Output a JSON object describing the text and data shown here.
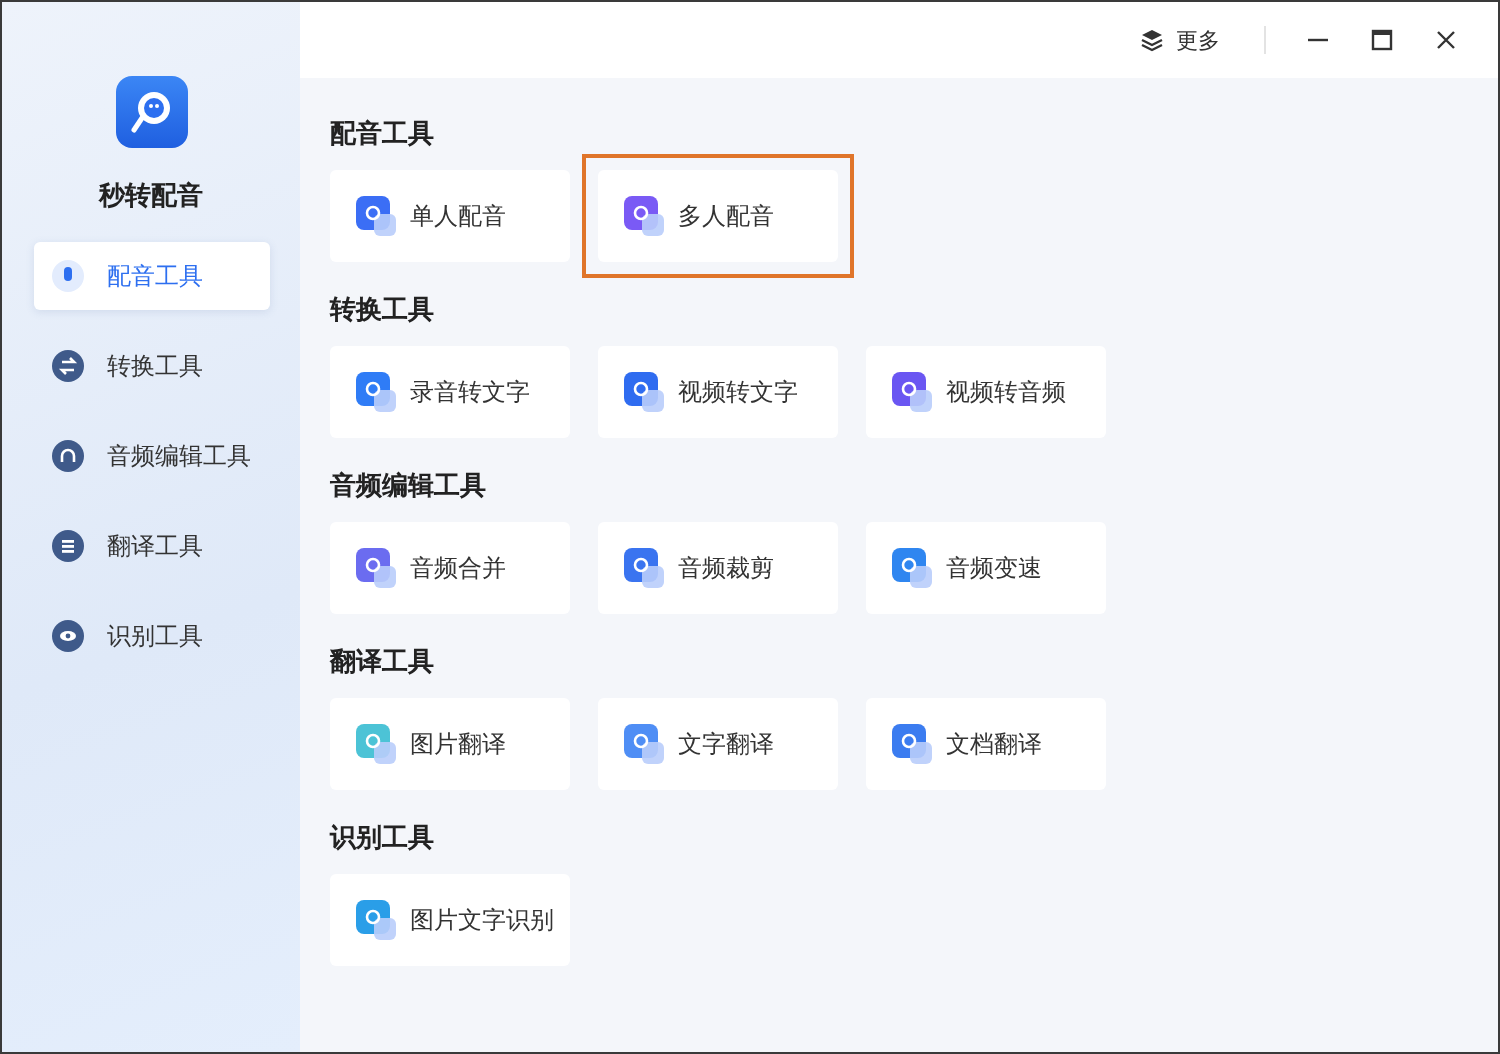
{
  "app": {
    "name": "秒转配音"
  },
  "sidebar": {
    "items": [
      {
        "label": "配音工具",
        "selected": true
      },
      {
        "label": "转换工具",
        "selected": false
      },
      {
        "label": "音频编辑工具",
        "selected": false
      },
      {
        "label": "翻译工具",
        "selected": false
      },
      {
        "label": "识别工具",
        "selected": false
      }
    ]
  },
  "titlebar": {
    "more": "更多"
  },
  "sections": [
    {
      "title": "配音工具",
      "tools": [
        {
          "label": "单人配音",
          "highlighted": false
        },
        {
          "label": "多人配音",
          "highlighted": true
        }
      ]
    },
    {
      "title": "转换工具",
      "tools": [
        {
          "label": "录音转文字",
          "highlighted": false
        },
        {
          "label": "视频转文字",
          "highlighted": false
        },
        {
          "label": "视频转音频",
          "highlighted": false
        }
      ]
    },
    {
      "title": "音频编辑工具",
      "tools": [
        {
          "label": "音频合并",
          "highlighted": false
        },
        {
          "label": "音频裁剪",
          "highlighted": false
        },
        {
          "label": "音频变速",
          "highlighted": false
        }
      ]
    },
    {
      "title": "翻译工具",
      "tools": [
        {
          "label": "图片翻译",
          "highlighted": false
        },
        {
          "label": "文字翻译",
          "highlighted": false
        },
        {
          "label": "文档翻译",
          "highlighted": false
        }
      ]
    },
    {
      "title": "识别工具",
      "tools": [
        {
          "label": "图片文字识别",
          "highlighted": false
        }
      ]
    }
  ]
}
